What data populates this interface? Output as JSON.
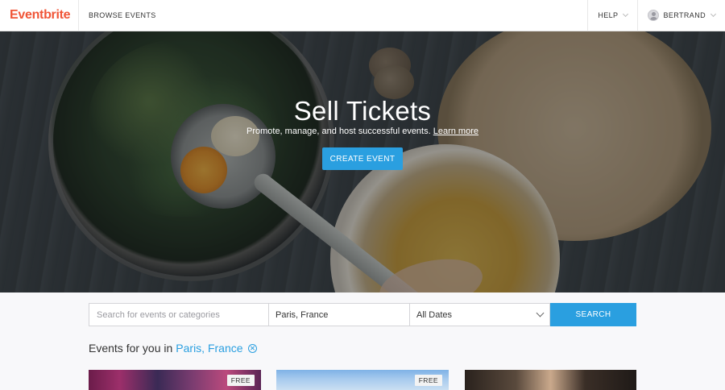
{
  "header": {
    "logo": "Eventbrite",
    "browse": "BROWSE EVENTS",
    "help": "HELP",
    "user": "BERTRAND"
  },
  "hero": {
    "title": "Sell Tickets",
    "subtitle": "Promote, manage, and host successful events.",
    "learn_more": "Learn more",
    "cta": "CREATE EVENT"
  },
  "search": {
    "placeholder": "Search for events or categories",
    "location": "Paris, France",
    "dates": "All Dates",
    "button": "SEARCH"
  },
  "events": {
    "heading_prefix": "Events for you in",
    "city": "Paris, France",
    "cards": [
      {
        "badge": "FREE"
      },
      {
        "badge": "FREE"
      },
      {
        "badge": ""
      }
    ]
  },
  "colors": {
    "brand": "#f05537",
    "accent": "#2a9fe0"
  }
}
